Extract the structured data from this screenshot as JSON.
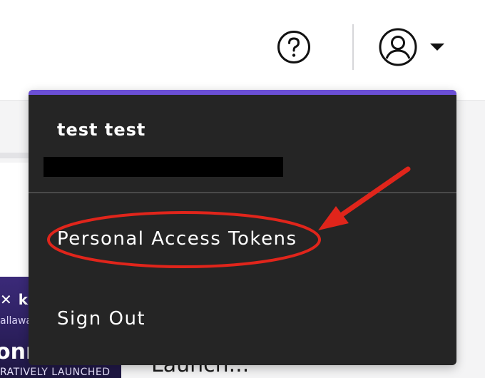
{
  "header": {
    "help_icon": "question-circle-icon",
    "avatar_icon": "user-circle-icon",
    "caret_icon": "caret-down-icon"
  },
  "background": {
    "thumbnail": {
      "brand_text": "✕ kā",
      "sub_text": "allawa",
      "big_text": "onne",
      "bottom_text": "RATIVELY LAUNCHED"
    },
    "card_title": "Launch..."
  },
  "user_menu": {
    "user_name": "test test",
    "items": [
      {
        "label": "Personal Access Tokens"
      },
      {
        "label": "Sign Out"
      }
    ]
  },
  "colors": {
    "menu_bg": "#252525",
    "menu_accent": "#6b4fd6",
    "annotation": "#e0251b"
  }
}
